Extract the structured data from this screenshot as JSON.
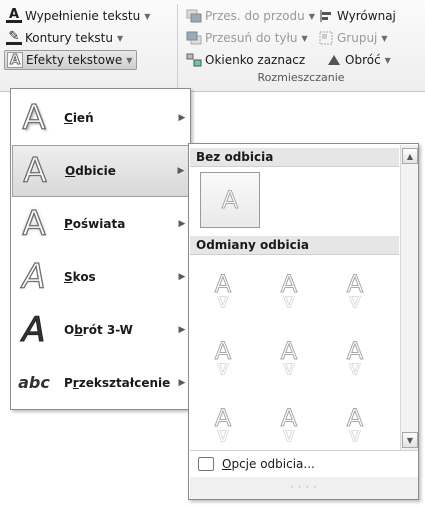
{
  "ribbon": {
    "left": [
      {
        "label": "Wypełnienie tekstu",
        "icon": "text-fill-icon",
        "glyph": "A"
      },
      {
        "label": "Kontury tekstu",
        "icon": "text-outline-icon",
        "glyph": "✎"
      },
      {
        "label": "Efekty tekstowe",
        "icon": "text-effects-icon",
        "glyph": "A"
      }
    ],
    "arrange": {
      "bring_forward": "Przes. do przodu",
      "send_backward": "Przesuń do tyłu",
      "selection_pane": "Okienko zaznacz",
      "align": "Wyrównaj",
      "group": "Grupuj",
      "rotate": "Obróć",
      "group_label": "Rozmieszczanie"
    }
  },
  "effects_menu": {
    "items": [
      {
        "label_u": "C",
        "label_rest": "ień"
      },
      {
        "label_u": "O",
        "label_rest": "dbicie",
        "selected": true
      },
      {
        "label_u": "P",
        "label_rest": "oświata"
      },
      {
        "label_u": "S",
        "label_rest": "kos"
      },
      {
        "label_pre": "O",
        "label_u": "b",
        "label_rest": "rót 3-W"
      },
      {
        "label_pre": "P",
        "label_u": "r",
        "label_rest": "zekształcenie"
      }
    ]
  },
  "reflection_menu": {
    "no_reflection_header": "Bez odbicia",
    "variants_header": "Odmiany odbicia",
    "sample_glyph": "A",
    "options_u": "O",
    "options_rest": "pcje odbicia..."
  }
}
